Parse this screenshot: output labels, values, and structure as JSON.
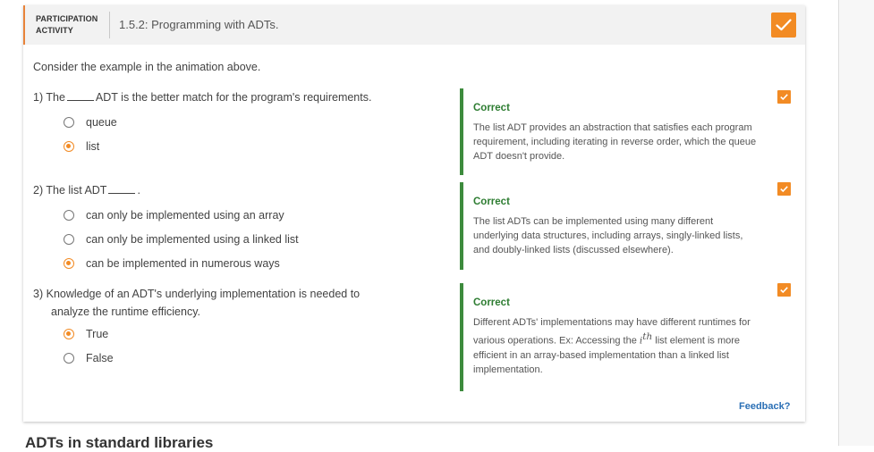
{
  "header": {
    "activity_label_line1": "PARTICIPATION",
    "activity_label_line2": "ACTIVITY",
    "title": "1.5.2: Programming with ADTs.",
    "completion_icon": "check-icon",
    "accent_color": "#f28b24"
  },
  "intro": "Consider the example in the animation above.",
  "questions": [
    {
      "number": "1)",
      "text_before": "The",
      "text_after": "ADT is the better match for the program's requirements.",
      "options": [
        "queue",
        "list"
      ],
      "selected": "list",
      "feedback_title": "Correct",
      "feedback_text": "The list ADT provides an abstraction that satisfies each program requirement, including iterating in reverse order, which the queue ADT doesn't provide."
    },
    {
      "number": "2)",
      "text_before": "The list ADT",
      "text_after": ".",
      "options": [
        "can only be implemented using an array",
        "can only be implemented using a linked list",
        "can be implemented in numerous ways"
      ],
      "selected": "can be implemented in numerous ways",
      "feedback_title": "Correct",
      "feedback_text": "The list ADTs can be implemented using many different underlying data structures, including arrays, singly-linked lists, and doubly-linked lists (discussed elsewhere)."
    },
    {
      "number": "3)",
      "text_line1": "Knowledge of an ADT's underlying implementation is needed to",
      "text_line2": "analyze the runtime efficiency.",
      "options": [
        "True",
        "False"
      ],
      "selected": "True",
      "feedback_title": "Correct",
      "feedback_text_part1": "Different ADTs' implementations may have different runtimes for various operations. Ex: Accessing the",
      "feedback_math_base": "i",
      "feedback_math_sup": "th",
      "feedback_text_part2": "list element is more efficient in an array-based implementation than a linked list implementation."
    }
  ],
  "feedback_link": "Feedback?",
  "next_section_heading": "ADTs in standard libraries"
}
